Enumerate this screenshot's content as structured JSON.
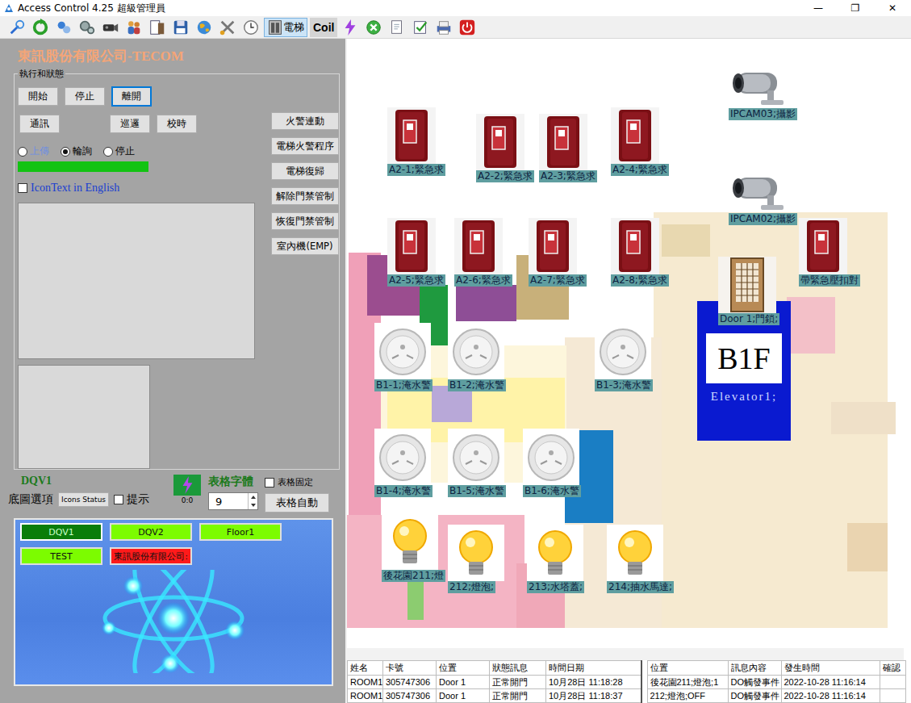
{
  "window": {
    "title": "Access Control 4.25 超級管理員",
    "controls": [
      "—",
      "❐",
      "✕"
    ]
  },
  "toolbar": {
    "items": [
      {
        "kind": "icon",
        "selected": false
      },
      {
        "kind": "icon",
        "selected": false
      },
      {
        "kind": "icon",
        "selected": false
      },
      {
        "kind": "icon",
        "selected": false
      },
      {
        "kind": "icon",
        "selected": false
      },
      {
        "kind": "icon",
        "selected": false
      },
      {
        "kind": "icon",
        "selected": false
      },
      {
        "kind": "icon",
        "selected": false
      },
      {
        "kind": "icon",
        "selected": false
      },
      {
        "kind": "icon",
        "selected": false
      },
      {
        "kind": "icon",
        "selected": false
      },
      {
        "kind": "labeled",
        "label": "電梯",
        "selected": true
      },
      {
        "kind": "text",
        "label": "Coil",
        "selected": false
      },
      {
        "kind": "icon",
        "selected": false
      },
      {
        "kind": "icon",
        "selected": false
      },
      {
        "kind": "icon",
        "selected": false
      },
      {
        "kind": "icon",
        "selected": false
      },
      {
        "kind": "icon",
        "selected": false
      },
      {
        "kind": "icon",
        "selected": false
      }
    ]
  },
  "left_panel": {
    "company": "東訊股份有限公司-TECOM",
    "group": {
      "legend": "執行和狀態",
      "row1": [
        {
          "label": "開始",
          "focused": false
        },
        {
          "label": "停止",
          "focused": false
        },
        {
          "label": "離開",
          "focused": true
        }
      ],
      "row2": [
        {
          "label": "通訊",
          "focused": false
        },
        {
          "label": "巡邏",
          "focused": false
        },
        {
          "label": "校時",
          "focused": false
        }
      ],
      "side_buttons": [
        "火警連動",
        "電梯火警程序",
        "電梯復歸",
        "解除門禁管制",
        "恢復門禁管制",
        "室內機(EMP)"
      ],
      "radios": [
        {
          "label": "上傳",
          "selected": false,
          "disabled": true
        },
        {
          "label": "輪詢",
          "selected": true,
          "disabled": false
        },
        {
          "label": "停止",
          "selected": false,
          "disabled": false
        }
      ],
      "progress": {
        "level": 1
      },
      "icon_text_english": {
        "label": "IconText in English",
        "checked": false
      }
    },
    "bottom": {
      "map_name": "DQV1",
      "basemap_label": "底圖選項",
      "icons_status": "Icons Status",
      "hint": {
        "label": "提示",
        "checked": false
      },
      "counter": "0:0",
      "font_label": "表格字體",
      "font_size": "9",
      "table_fixed": {
        "label": "表格固定",
        "checked": false
      },
      "auto_button": "表格自動"
    },
    "maps": {
      "buttons": [
        {
          "label": "DQV1",
          "selected": true,
          "color": "#0a7d0a"
        },
        {
          "label": "DQV2",
          "selected": false,
          "color": "#7cfc00"
        },
        {
          "label": "Floor1",
          "selected": false,
          "color": "#7cfc00"
        },
        {
          "label": "TEST",
          "selected": false,
          "color": "#7cfc00"
        },
        {
          "label": "東訊股份有限公司:",
          "selected": false,
          "color": "#ff1a1a"
        }
      ]
    }
  },
  "map": {
    "devices": [
      {
        "kind": "emergency",
        "label": "A2-1;緊急求"
      },
      {
        "kind": "emergency",
        "label": "A2-2;緊急求"
      },
      {
        "kind": "emergency",
        "label": "A2-3;緊急求"
      },
      {
        "kind": "emergency",
        "label": "A2-4;緊急求"
      },
      {
        "kind": "emergency",
        "label": "A2-5;緊急求"
      },
      {
        "kind": "emergency",
        "label": "A2-6;緊急求"
      },
      {
        "kind": "emergency",
        "label": "A2-7;緊急求"
      },
      {
        "kind": "emergency",
        "label": "A2-8;緊急求"
      },
      {
        "kind": "emergency",
        "label": "帶緊急壓扣對"
      },
      {
        "kind": "camera",
        "label": "IPCAM03;攝影"
      },
      {
        "kind": "camera",
        "label": "IPCAM02;攝影"
      },
      {
        "kind": "door",
        "label": "Door 1;門鎖;"
      },
      {
        "kind": "water",
        "label": "B1-1;淹水警"
      },
      {
        "kind": "water",
        "label": "B1-2;淹水警"
      },
      {
        "kind": "water",
        "label": "B1-3;淹水警"
      },
      {
        "kind": "water",
        "label": "B1-4;淹水警"
      },
      {
        "kind": "water",
        "label": "B1-5;淹水警"
      },
      {
        "kind": "water",
        "label": "B1-6;淹水警"
      },
      {
        "kind": "bulb",
        "label": "後花園211;燈"
      },
      {
        "kind": "bulb",
        "label": "212;燈泡;"
      },
      {
        "kind": "bulb",
        "label": "213;水塔蓋;"
      },
      {
        "kind": "bulb",
        "label": "214;抽水馬達;"
      }
    ],
    "elevator": {
      "floor": "B1F",
      "label": "Elevator1;"
    }
  },
  "event_table": {
    "columns": [
      "姓名",
      "卡號",
      "位置",
      "狀態訊息",
      "時間日期"
    ],
    "rows": [
      [
        "ROOM1",
        "305747306",
        "Door 1",
        "正常開門",
        "10月28日 11:18:28"
      ],
      [
        "ROOM1",
        "305747306",
        "Door 1",
        "正常開門",
        "10月28日 11:18:37"
      ]
    ]
  },
  "alarm_table": {
    "columns": [
      "位置",
      "訊息內容",
      "發生時間",
      "確認"
    ],
    "rows": [
      [
        "後花園211;燈泡;1",
        "DO觸發事件",
        "2022-10-28 11:16:14"
      ],
      [
        "212;燈泡;OFF",
        "DO觸發事件",
        "2022-10-28 11:16:14"
      ]
    ]
  }
}
